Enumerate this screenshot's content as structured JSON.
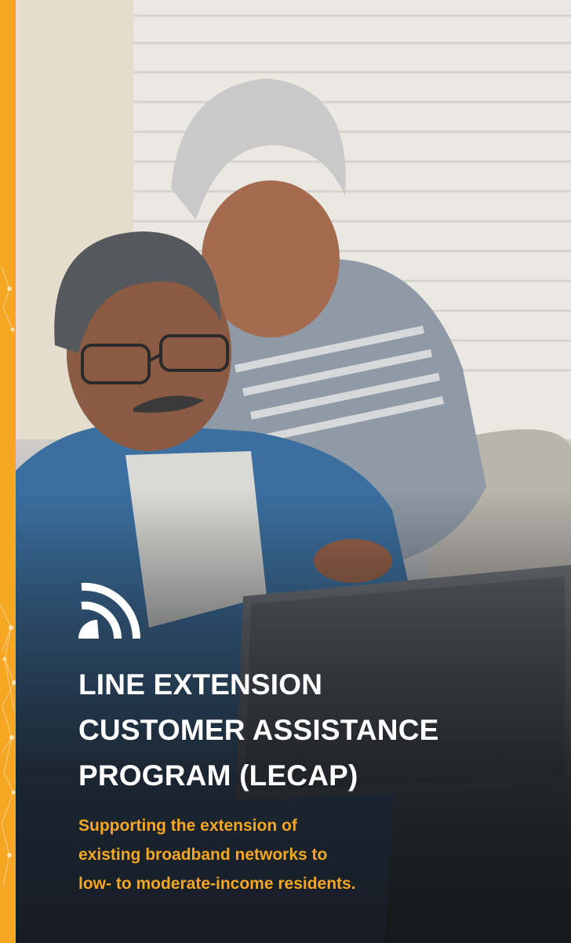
{
  "brand": {
    "accent_color": "#f5a623",
    "text_color": "#ffffff"
  },
  "icon": "wifi-broadcast-icon",
  "title_lines": [
    "LINE EXTENSION",
    "CUSTOMER ASSISTANCE",
    "PROGRAM (LECAP)"
  ],
  "subtitle_lines": [
    "Supporting the extension of",
    "existing broadband networks to",
    "low- to moderate-income residents."
  ]
}
